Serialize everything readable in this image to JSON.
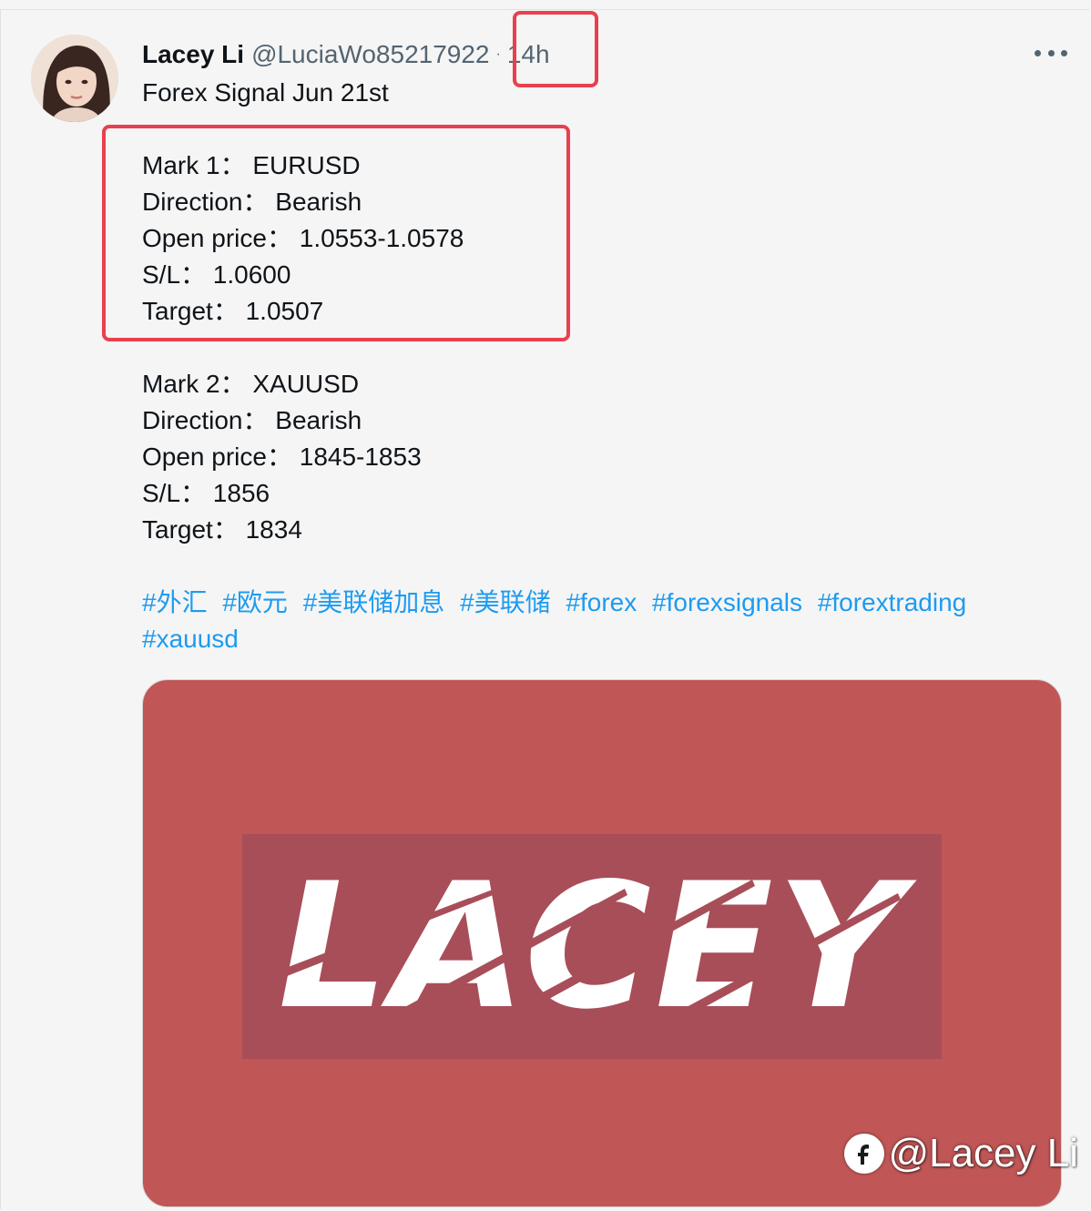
{
  "post": {
    "display_name": "Lacey Li",
    "handle": "@LuciaWo85217922",
    "separator": "·",
    "time": "14h",
    "subtitle": "Forex Signal  Jun 21st",
    "signals": [
      {
        "mark": "Mark 1：  EURUSD",
        "direction": "Direction：  Bearish",
        "open_price": "Open price：  1.0553-1.0578",
        "stop_loss": "S/L：  1.0600",
        "target": "Target：  1.0507"
      },
      {
        "mark": "Mark 2：  XAUUSD",
        "direction": "Direction：  Bearish",
        "open_price": "Open price：  1845-1853",
        "stop_loss": "S/L：  1856",
        "target": "Target：  1834"
      }
    ],
    "hashtags": [
      "#外汇",
      "#欧元",
      "#美联储加息",
      "#美联储",
      "#forex",
      "#forexsignals",
      "#forextrading",
      "#xauusd"
    ],
    "media": {
      "logo_text": "LACEY"
    }
  },
  "watermark": {
    "icon": "brand-logo-icon",
    "text": "@Lacey Li"
  },
  "colors": {
    "highlight_box": "#e8404e",
    "hashtag": "#1d9bf0",
    "media_bg": "#c05656",
    "logo_band": "#a84e59"
  },
  "icons": {
    "more": "more-horizontal-icon"
  }
}
